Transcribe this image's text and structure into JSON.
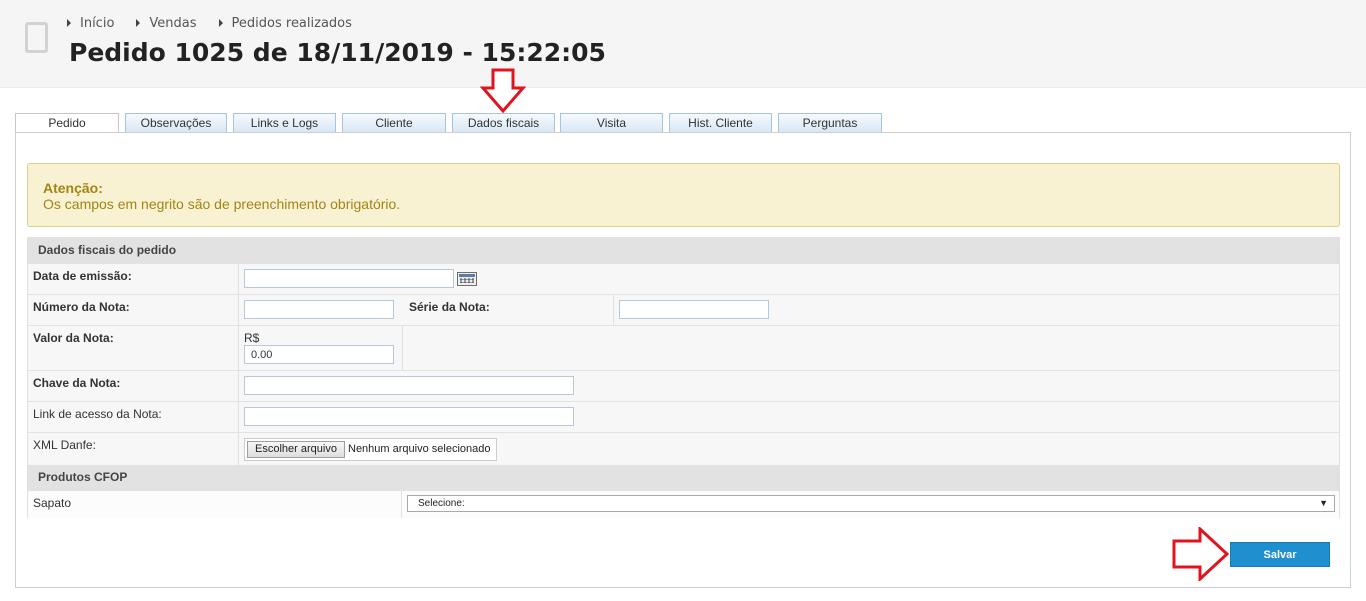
{
  "breadcrumb": [
    "Início",
    "Vendas",
    "Pedidos realizados"
  ],
  "page_title": "Pedido 1025 de 18/11/2019 - 15:22:05",
  "tabs": [
    "Pedido",
    "Observações",
    "Links e Logs",
    "Cliente",
    "Dados fiscais",
    "Visita",
    "Hist. Cliente",
    "Perguntas"
  ],
  "active_tab": "Dados fiscais",
  "alert": {
    "title": "Atenção:",
    "text": "Os campos em negrito são de preenchimento obrigatório."
  },
  "form": {
    "section_fiscal": "Dados fiscais do pedido",
    "data_emissao_label": "Data de emissão:",
    "data_emissao_value": "",
    "numero_nota_label": "Número da Nota:",
    "numero_nota_value": "",
    "serie_nota_label": "Série da Nota:",
    "serie_nota_value": "",
    "valor_nota_label": "Valor da Nota:",
    "currency": "R$",
    "valor_nota_value": "0.00",
    "chave_nota_label": "Chave da Nota:",
    "chave_nota_value": "",
    "link_acesso_label": "Link de acesso da Nota:",
    "link_acesso_value": "",
    "xml_danfe_label": "XML Danfe:",
    "file_button": "Escolher arquivo",
    "file_status": "Nenhum arquivo selecionado",
    "section_cfop": "Produtos CFOP",
    "product_label": "Sapato",
    "select_value": "Selecione:"
  },
  "save_label": "Salvar",
  "colors": {
    "save_button": "#1f8fd0",
    "alert_bg": "#f8f2d3",
    "alert_text": "#a38415",
    "annotation_arrow": "#e0141e"
  }
}
